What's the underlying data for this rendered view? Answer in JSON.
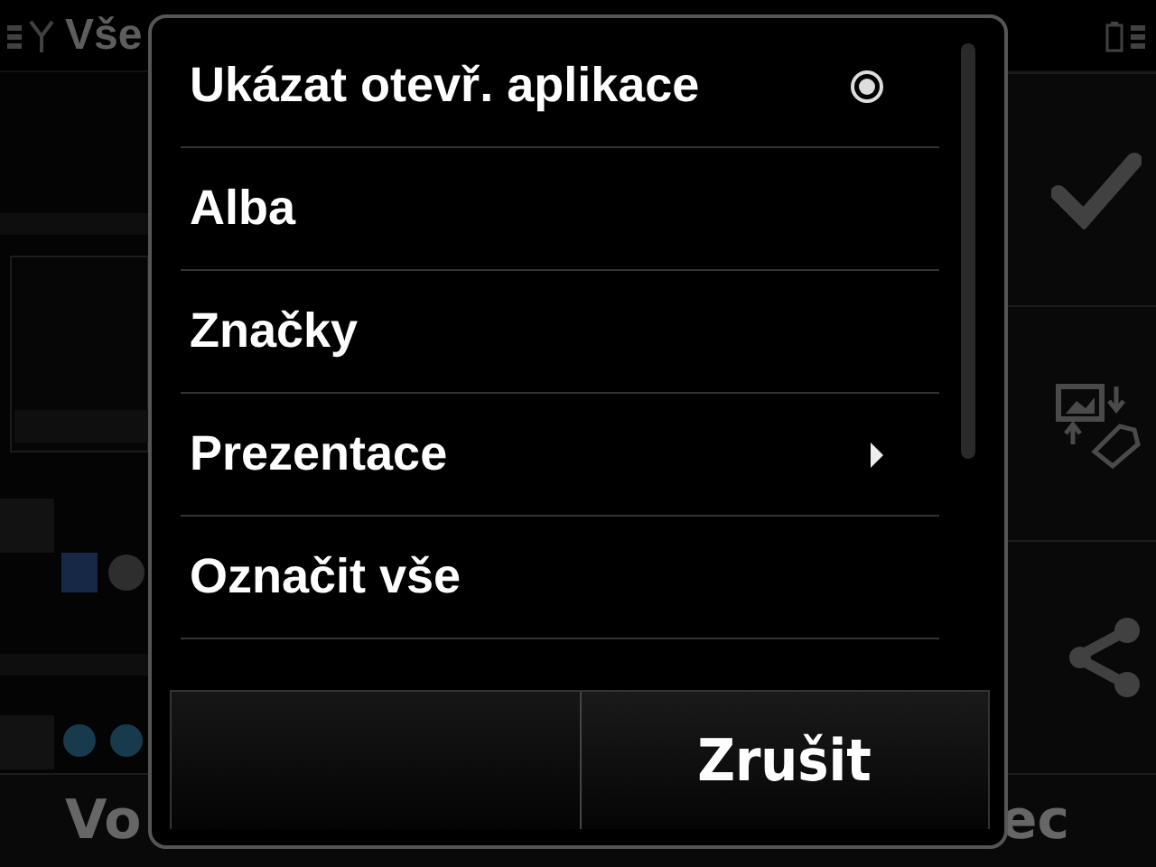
{
  "screen": {
    "title": "Vše",
    "softkeys": [
      {
        "label": "Vo"
      },
      {
        "label": "ec"
      }
    ]
  },
  "menu": {
    "items": [
      {
        "label": "Ukázat otevř. aplikace",
        "kind": "radio",
        "checked": true
      },
      {
        "label": "Alba",
        "kind": "plain"
      },
      {
        "label": "Značky",
        "kind": "plain"
      },
      {
        "label": "Prezentace",
        "kind": "submenu"
      },
      {
        "label": "Označit vše",
        "kind": "plain"
      }
    ],
    "buttons": [
      {
        "kind": "blank"
      },
      {
        "kind": "cancel",
        "label": "Zrušit"
      }
    ]
  }
}
